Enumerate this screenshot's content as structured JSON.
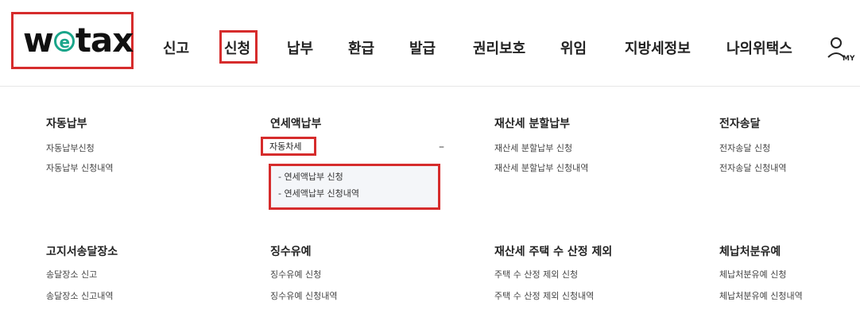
{
  "logo": {
    "part1": "w",
    "e": "e",
    "part2": "tax"
  },
  "nav": [
    "신고",
    "신청",
    "납부",
    "환급",
    "발급",
    "권리보호",
    "위임",
    "지방세정보",
    "나의위택스"
  ],
  "my_icon": {
    "label": "MY",
    "icon": "user-icon"
  },
  "sections": [
    {
      "title": "자동납부",
      "links": [
        "자동납부신청",
        "자동납부 신청내역"
      ]
    },
    {
      "title": "연세액납부",
      "links": [
        "자동차세"
      ],
      "submenu": [
        "- 연세액납부 신청",
        "- 연세액납부 신청내역"
      ],
      "collapse": "–"
    },
    {
      "title": "재산세 분할납부",
      "links": [
        "재산세 분할납부 신청",
        "재산세 분할납부 신청내역"
      ]
    },
    {
      "title": "전자송달",
      "links": [
        "전자송달 신청",
        "전자송달 신청내역"
      ]
    },
    {
      "title": "고지서송달장소",
      "links": [
        "송달장소 신고",
        "송달장소 신고내역"
      ]
    },
    {
      "title": "징수유예",
      "links": [
        "징수유예 신청",
        "징수유예 신청내역"
      ]
    },
    {
      "title": "재산세 주택 수 산정 제외",
      "links": [
        "주택 수 산정 제외 신청",
        "주택 수 산정 제외 신청내역"
      ]
    },
    {
      "title": "체납처분유예",
      "links": [
        "체납처분유예 신청",
        "체납처분유예 신청내역"
      ]
    }
  ],
  "colors": {
    "highlight": "#d62c2c",
    "logo_accent": "#1aa58a"
  }
}
